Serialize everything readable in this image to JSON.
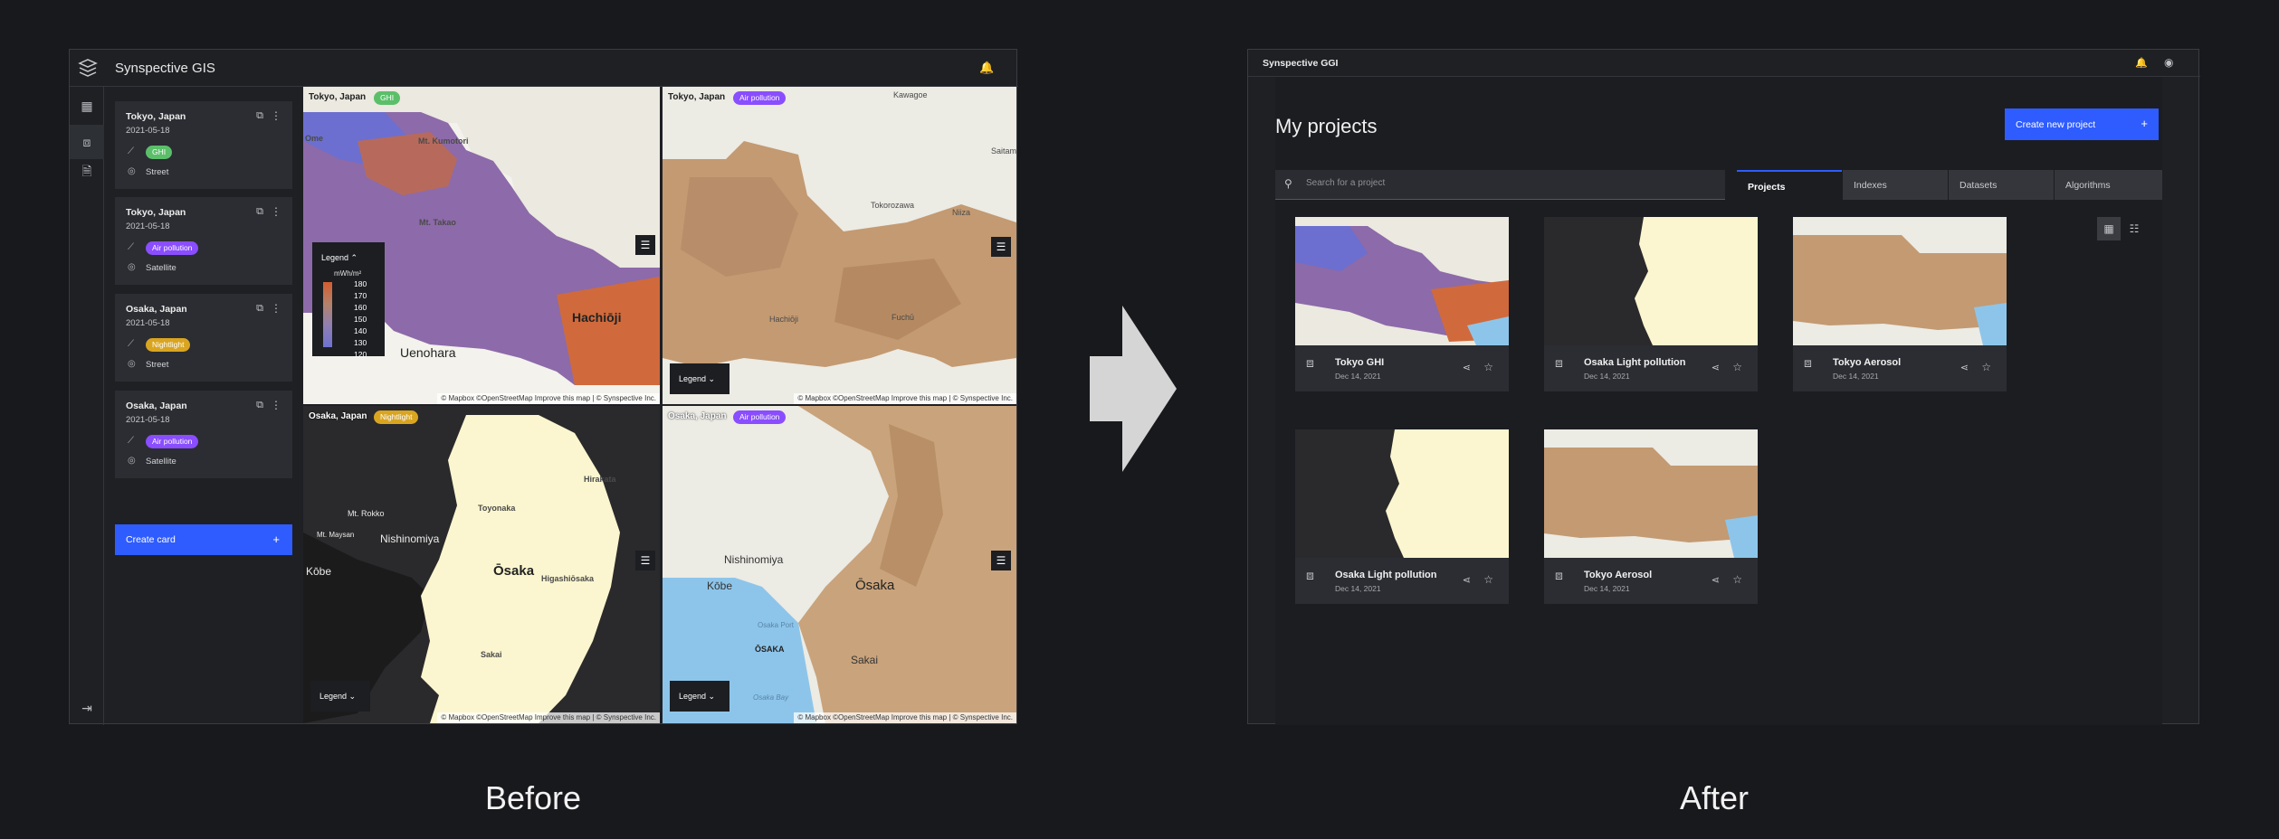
{
  "before": {
    "app_title": "Synspective GIS",
    "cards": [
      {
        "title": "Tokyo, Japan",
        "date": "2021-05-18",
        "indicator": "GHI",
        "indicator_color": "#5bbf6a",
        "layer": "Street"
      },
      {
        "title": "Tokyo, Japan",
        "date": "2021-05-18",
        "indicator": "Air pollution",
        "indicator_color": "#8a4dff",
        "layer": "Satellite"
      },
      {
        "title": "Osaka, Japan",
        "date": "2021-05-18",
        "indicator": "Nightlight",
        "indicator_color": "#d9a521",
        "layer": "Street"
      },
      {
        "title": "Osaka, Japan",
        "date": "2021-05-18",
        "indicator": "Air pollution",
        "indicator_color": "#8a4dff",
        "layer": "Satellite"
      }
    ],
    "create_card": "Create card",
    "maps": [
      {
        "location": "Tokyo, Japan",
        "indicator": "GHI",
        "badge_color": "#5bbf6a",
        "places": [
          "Mt. Kumotori",
          "Ome",
          "Mt. Takao",
          "Hachiōji",
          "Uenohara"
        ]
      },
      {
        "location": "Tokyo, Japan",
        "indicator": "Air pollution",
        "badge_color": "#8a4dff",
        "places": [
          "Kawagoe",
          "Tokorozawa",
          "Niiza",
          "Hachiōji",
          "Fuchū",
          "Saitama"
        ]
      },
      {
        "location": "Osaka, Japan",
        "indicator": "Nightlight",
        "badge_color": "#d9a521",
        "places": [
          "Hirakata",
          "Toyonaka",
          "Mt. Rokko",
          "Nishinomiya",
          "Ōsaka",
          "Higashiōsaka",
          "Kōbe",
          "Sakai",
          "Mt. Maysan"
        ]
      },
      {
        "location": "Osaka, Japan",
        "indicator": "Air pollution",
        "badge_color": "#8a4dff",
        "places": [
          "Nishinomiya",
          "Kōbe",
          "Ōsaka",
          "ŌSAKA",
          "Sakai",
          "Osaka Port",
          "Osaka Bay"
        ]
      }
    ],
    "legend": {
      "title": "Legend",
      "unit": "mWh/m²",
      "ticks": [
        "180",
        "170",
        "160",
        "150",
        "140",
        "130",
        "120"
      ]
    },
    "legend_button": "Legend",
    "attribution": "© Mapbox ©OpenStreetMap Improve this map | © Synspective Inc."
  },
  "after": {
    "app_title": "Synspective GGI",
    "page_title": "My projects",
    "create_button": "Create new project",
    "search_placeholder": "Search for a project",
    "tabs": [
      "Projects",
      "Indexes",
      "Datasets",
      "Algorithms"
    ],
    "projects": [
      {
        "title": "Tokyo GHI",
        "date": "Dec 14, 2021"
      },
      {
        "title": "Osaka Light pollution",
        "date": "Dec 14, 2021"
      },
      {
        "title": "Tokyo Aerosol",
        "date": "Dec 14, 2021"
      },
      {
        "title": "Osaka Light pollution",
        "date": "Dec 14, 2021"
      },
      {
        "title": "Tokyo Aerosol",
        "date": "Dec 14, 2021"
      }
    ]
  },
  "captions": {
    "before": "Before",
    "after": "After"
  }
}
